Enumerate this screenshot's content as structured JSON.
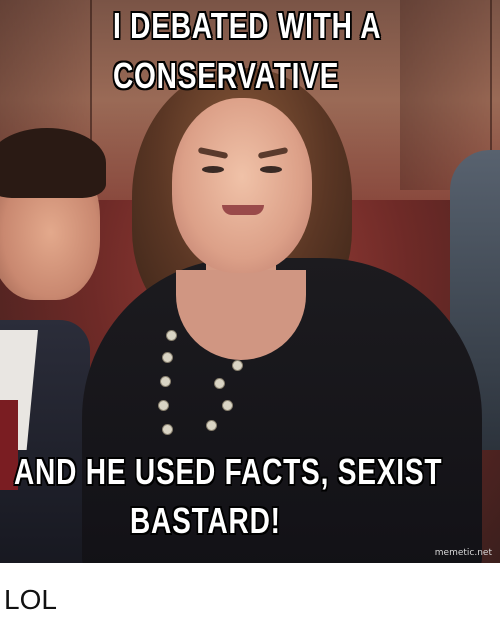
{
  "meme": {
    "top_line_1": "I DEBATED WITH A",
    "top_line_2": "CONSERVATIVE",
    "bottom_line_1": "AND HE USED FACTS, SEXIST",
    "bottom_line_2": "BASTARD!",
    "watermark": "memetic.net"
  },
  "caption": "LOL",
  "colors": {
    "meme_text": "#ffffff",
    "meme_outline": "#000000",
    "caption_text": "#111111",
    "background": "#ffffff"
  }
}
